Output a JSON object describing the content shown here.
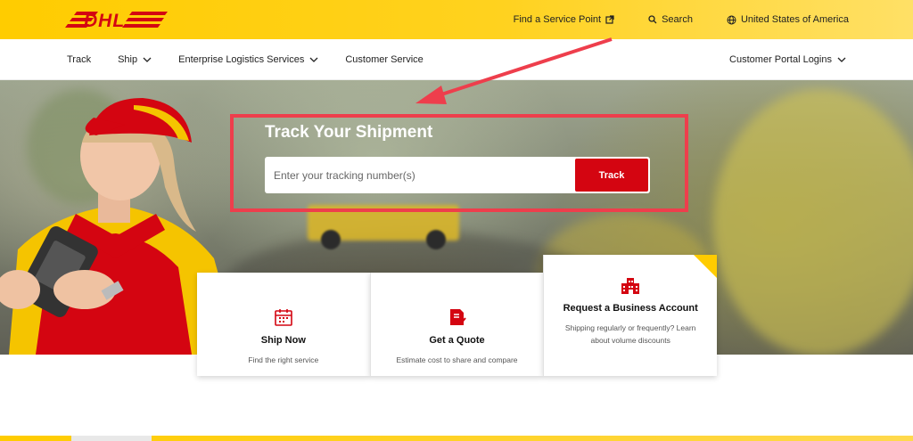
{
  "header": {
    "logo_text": "DHL",
    "links": [
      {
        "label": "Find a Service Point",
        "icon": "external-link-icon"
      },
      {
        "label": "Search",
        "icon": "search-icon"
      },
      {
        "label": "United States of America",
        "icon": "globe-icon"
      }
    ]
  },
  "nav": {
    "items": [
      {
        "label": "Track",
        "has_dropdown": false
      },
      {
        "label": "Ship",
        "has_dropdown": true
      },
      {
        "label": "Enterprise Logistics Services",
        "has_dropdown": true
      },
      {
        "label": "Customer Service",
        "has_dropdown": false
      }
    ],
    "right_item": {
      "label": "Customer Portal Logins",
      "has_dropdown": true
    }
  },
  "hero": {
    "title": "Track Your Shipment",
    "input_placeholder": "Enter your tracking number(s)",
    "input_value": "",
    "button_label": "Track"
  },
  "cards": [
    {
      "title": "Ship Now",
      "description": "Find the right service",
      "icon": "calendar-icon"
    },
    {
      "title": "Get a Quote",
      "description": "Estimate cost to share and compare",
      "icon": "quote-document-icon"
    },
    {
      "title": "Request a Business Account",
      "description": "Shipping regularly or frequently? Learn about volume discounts",
      "icon": "building-icon"
    }
  ],
  "colors": {
    "brand_yellow": "#ffcc00",
    "brand_red": "#d40511",
    "annotation_red": "#ee3e4c"
  }
}
